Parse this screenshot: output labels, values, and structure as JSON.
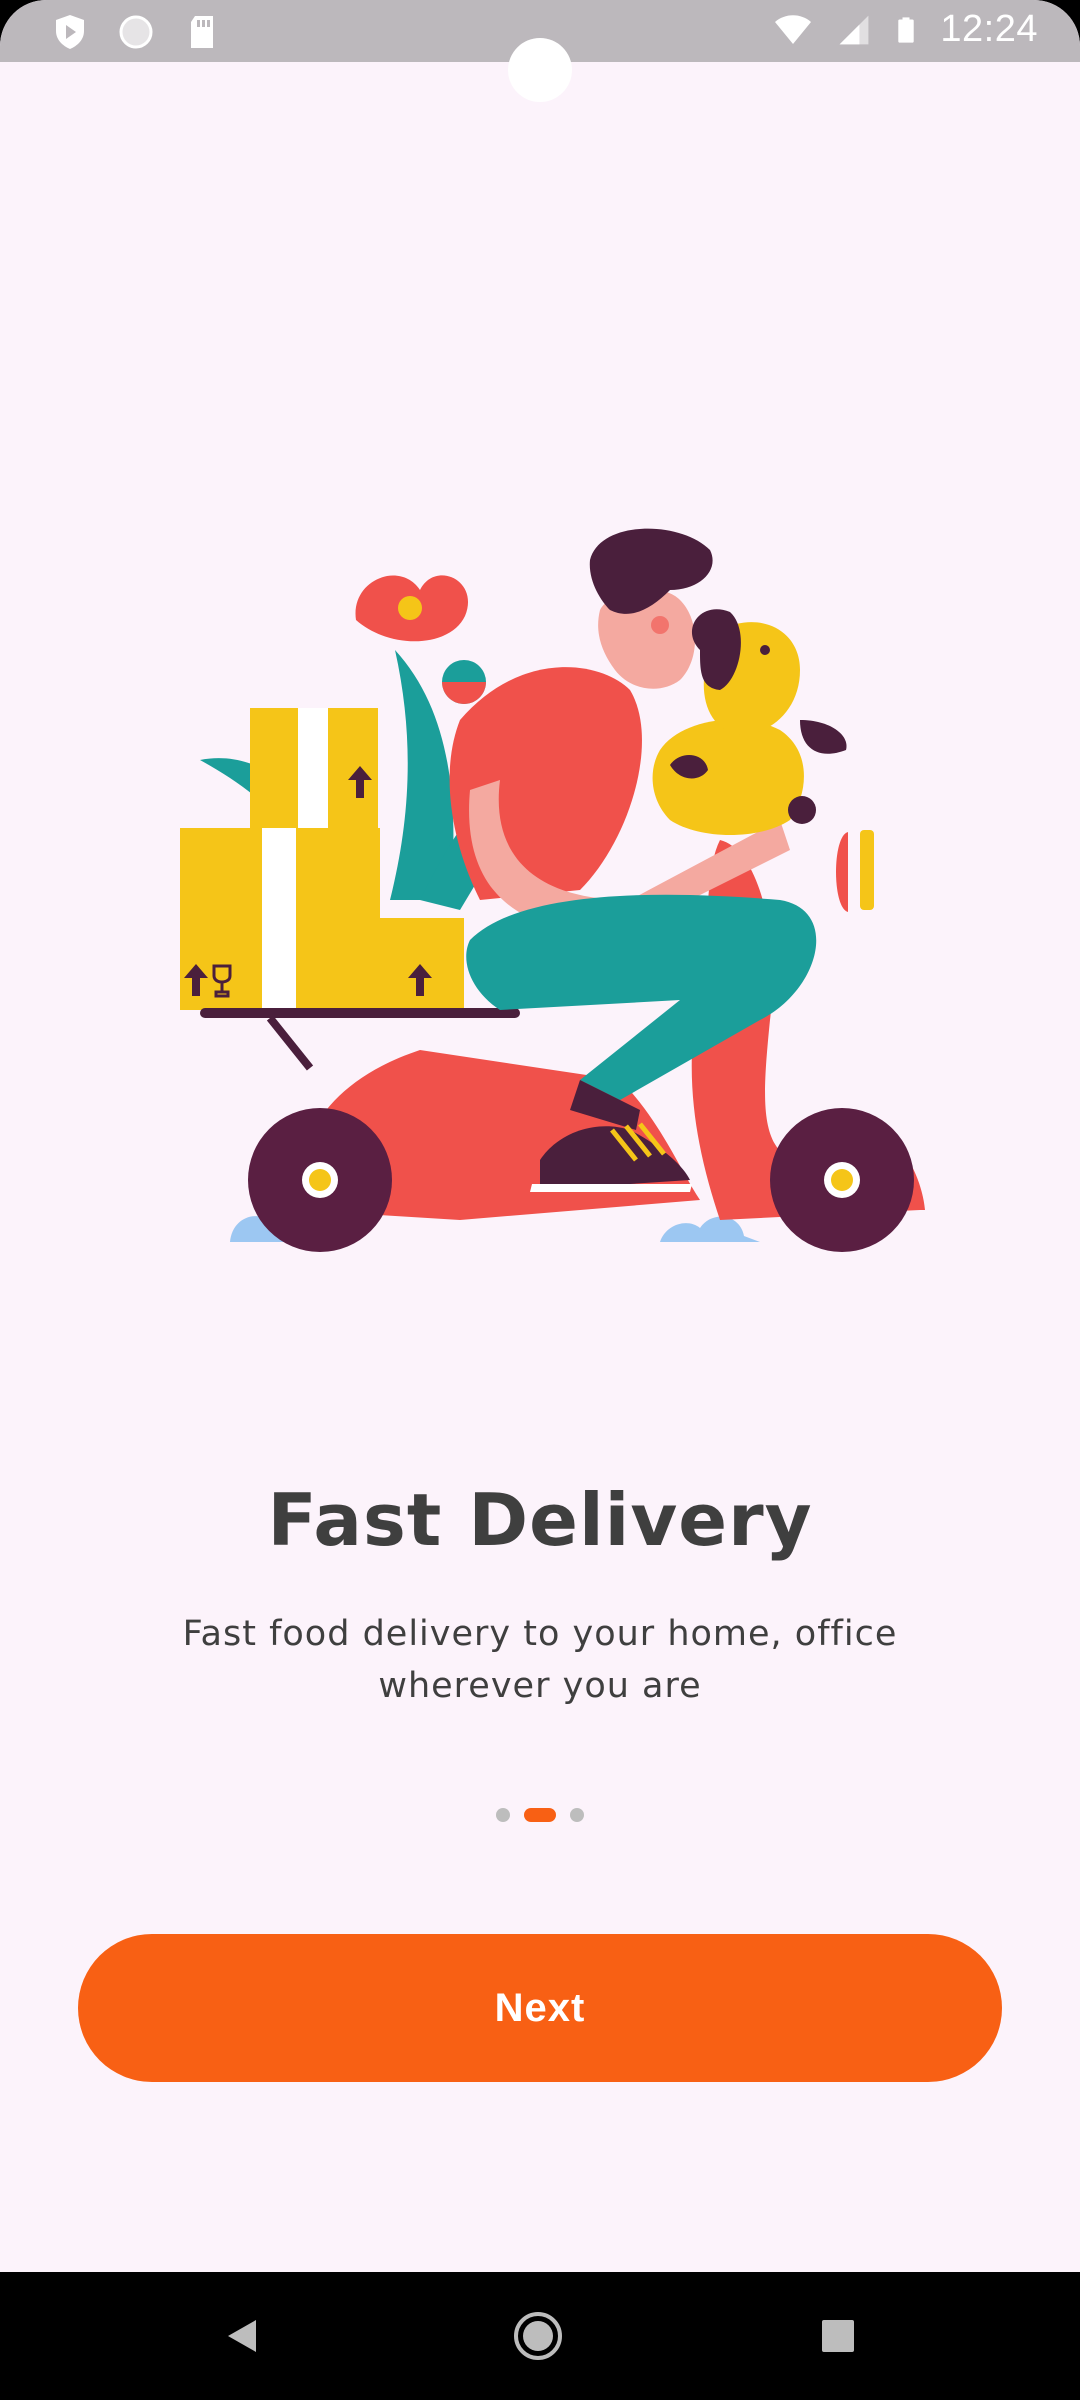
{
  "status_bar": {
    "time": "12:24",
    "left_icons": [
      "shield-play-icon",
      "circle-icon",
      "sd-card-icon"
    ],
    "right_icons": [
      "wifi-icon",
      "signal-icon",
      "battery-icon"
    ]
  },
  "onboarding": {
    "illustration": "delivery-scooter-illustration",
    "title": "Fast Delivery",
    "subtitle_line1": "Fast food delivery to your home, office",
    "subtitle_line2": "wherever you are",
    "page_indicator": {
      "total": 3,
      "current": 2
    },
    "next_label": "Next"
  },
  "nav_bar": {
    "buttons": [
      "back-icon",
      "home-icon",
      "recents-icon"
    ]
  },
  "colors": {
    "accent": "#f86014",
    "background": "#fcf3fb",
    "text": "#3f3f3f",
    "status_bar": "#bcb8bc"
  }
}
